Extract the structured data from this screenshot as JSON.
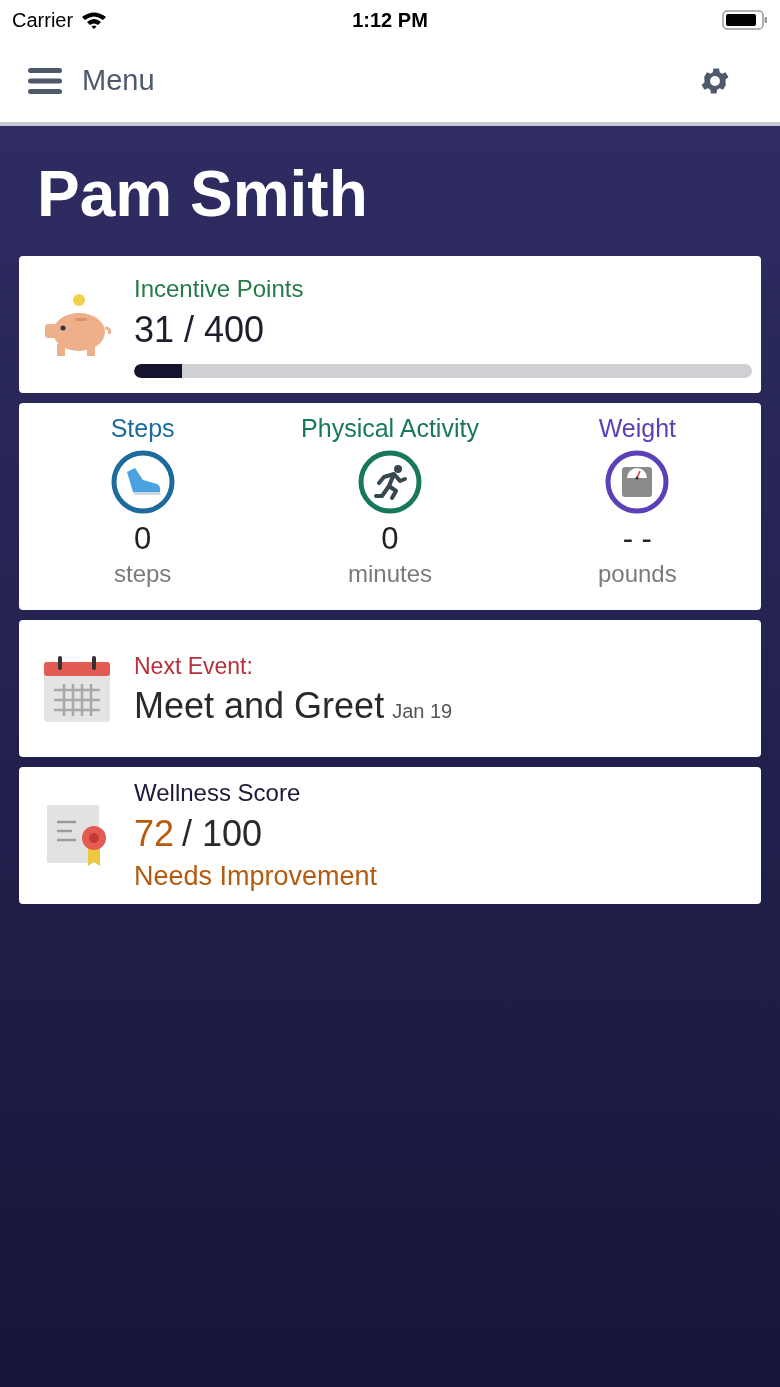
{
  "status_bar": {
    "carrier": "Carrier",
    "time": "1:12 PM"
  },
  "nav": {
    "menu_label": "Menu"
  },
  "user_name": "Pam Smith",
  "incentive": {
    "title": "Incentive Points",
    "value": "31 / 400",
    "level": 0.078
  },
  "metrics": [
    {
      "kind": "shoe",
      "title": "Steps",
      "color": "#1c6b9c",
      "value": "0",
      "unit": "steps"
    },
    {
      "kind": "runner",
      "title": "Physical Activity",
      "color": "#17785c",
      "value": "0",
      "unit": "minutes"
    },
    {
      "kind": "scale",
      "title": "Weight",
      "color": "#5b40b8",
      "value": "- -",
      "unit": "pounds"
    }
  ],
  "next_event": {
    "label": "Next Event:",
    "name": "Meet and Greet",
    "date": "Jan 19"
  },
  "wellness": {
    "title": "Wellness Score",
    "score": "72",
    "total": "/ 100",
    "rating": "Needs Improvement"
  }
}
